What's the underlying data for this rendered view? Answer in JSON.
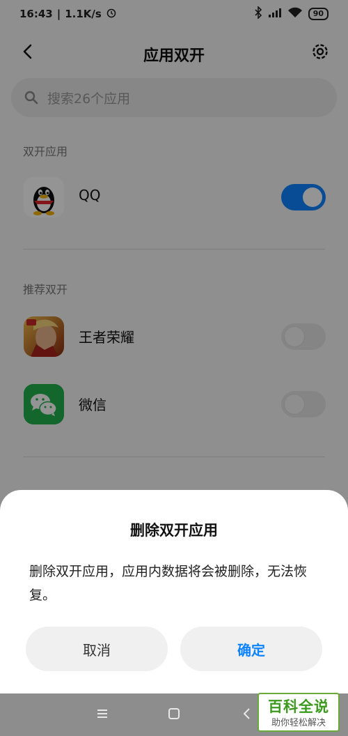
{
  "status_bar": {
    "time": "16:43",
    "speed": "1.1K/s",
    "battery": "90"
  },
  "header": {
    "title": "应用双开"
  },
  "search": {
    "placeholder": "搜索26个应用"
  },
  "sections": {
    "dual_apps_label": "双开应用",
    "recommended_label": "推荐双开"
  },
  "apps": {
    "qq": {
      "name": "QQ",
      "enabled": true
    },
    "wzry": {
      "name": "王者荣耀",
      "enabled": false
    },
    "wechat": {
      "name": "微信",
      "enabled": false
    }
  },
  "dialog": {
    "title": "删除双开应用",
    "message": "删除双开应用，应用内数据将会被删除，无法恢复。",
    "cancel_label": "取消",
    "confirm_label": "确定"
  },
  "watermark": {
    "title": "百科全说",
    "subtitle": "助你轻松解决"
  },
  "colors": {
    "accent": "#0d84ff",
    "wechat_green": "#22b14c",
    "watermark_green": "#3b9a1e"
  },
  "icons": {
    "back": "chevron-left-icon",
    "settings": "gear-icon",
    "search": "search-icon",
    "bluetooth": "bluetooth-icon",
    "signal": "signal-icon",
    "wifi": "wifi-icon",
    "alarm": "alarm-icon"
  }
}
